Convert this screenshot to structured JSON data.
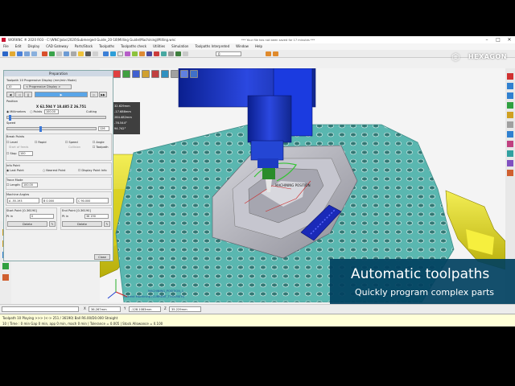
{
  "window": {
    "title": "WORKNC ® 2020 R03 - C:\\WNC\\Jobs\\2020\\Submerged Guide_20-18\\Milling Guide\\Machining\\Milling.wnc",
    "notice": "*** Your file has not been saved for 17 minutes ***",
    "minimize": "–",
    "maximize": "□",
    "close": "✕"
  },
  "menu": [
    "File",
    "Edit",
    "Display",
    "CAD Gateway",
    "Parts/Stock",
    "Toolpaths",
    "Toolpaths check",
    "Utilities",
    "Simulation",
    "Toolpaths Interpreted",
    "Window",
    "Help"
  ],
  "toolbar": {
    "combo_value": "0"
  },
  "brand": {
    "name": "HEXAGON"
  },
  "dialog": {
    "title": "Preparation",
    "subtitle": "Toolpath 10 Progressive Display (mm/min Mode)",
    "toolpath_select": "10",
    "mode_select": "< Progressive Display >",
    "position_label": "Position",
    "coords": "X 62.504  Y 18.485  Z 26.751",
    "millimeters": "Millimeters",
    "points": "Points",
    "points_value": "100.00",
    "cutting": "Cutting",
    "speed_label": "Speed",
    "speed_value": "126",
    "break_points": "Break Points",
    "bp_items": [
      "Level",
      "Rapid",
      "Speed",
      "Angle",
      "Start of feeds",
      "Collision",
      "Toolpath"
    ],
    "stop": "Stop",
    "stop_value": "100",
    "info_point": "Info Point",
    "last_point": "Last Point",
    "nearest_point": "Nearest Point",
    "display_point_info": "Display Point Info",
    "trace_mode": "Trace Mode",
    "length": "Length",
    "length_value": "100.00",
    "machine_angles": "Machine Angles",
    "angle_a": "A -55.193",
    "angle_b": "B 0.000",
    "angle_c": "C 90.000",
    "start_point": "Start Point [0-36190]",
    "end_point": "End Point [0-36190]",
    "pt_in": "Pt in",
    "start_value": "0",
    "end_value": "36 190",
    "delete": "Delete",
    "close": "Close"
  },
  "readout": {
    "rows": [
      "32.629mm",
      "-17.686mm",
      "284.482mm",
      "-76.544°",
      "94.742°"
    ]
  },
  "viewport": {
    "annotation_1": "MACHINING POSITION",
    "annotation_2": "MACHINING_POSITION_1",
    "annotation_3": "Current Machining (CURRENT_TOOLPATH)"
  },
  "coords": {
    "x_label": "X",
    "x_value": "36.267mm",
    "y_label": "Y",
    "y_value": "-128.1083mm",
    "z_label": "Z",
    "z_value": "35.229mm"
  },
  "status": {
    "line1": "Toolpath 10    Playing >>> (<-> 251 / 36190)          Ball R6.00/D0.000 Straight",
    "line2": "10 | Time : 0 min Gap 0 min, app 0 min, mach 0 min | Tolerance = 0.005 | Stock Allowance = 0.100"
  },
  "overlay": {
    "title": "Automatic toolpaths",
    "subtitle": "Quickly program complex parts"
  },
  "colors": {
    "machine_blue": "#1a35c8",
    "table_teal": "#5ab7b0",
    "fixture_yellow": "#e8df10",
    "part_grey": "#b8b8c0",
    "overlay_bg": "#004060"
  }
}
